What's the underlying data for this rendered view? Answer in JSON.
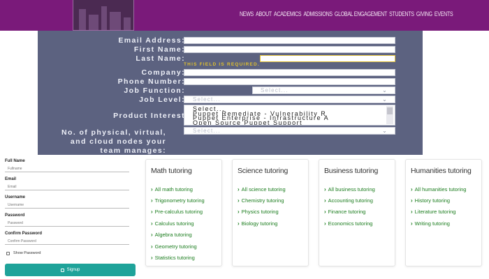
{
  "nav": {
    "items": [
      "NEWS",
      "ABOUT",
      "ACADEMICS",
      "ADMISSIONS",
      "GLOBAL ENGAGEMENT",
      "STUDENTS",
      "GIVING",
      "EVENTS"
    ]
  },
  "lead_form": {
    "email_label": "Email Address:",
    "first_name_label": "First Name:",
    "last_name_label": "Last Name:",
    "last_name_error": "THIS FIELD IS REQUIRED.",
    "company_label": "Company:",
    "phone_label": "Phone Number:",
    "job_function_label": "Job Function:",
    "job_function_placeholder": "Select...",
    "job_level_label": "Job Level:",
    "job_level_placeholder": "Select...",
    "product_interest_label": "Product Interest",
    "product_interest_options": [
      "Select...",
      "Puppet Remediate - Vulnerability R",
      "Puppet Enterprise - Infrastructure A",
      "Open Source Puppet Support"
    ],
    "nodes_label": "No. of physical, virtual, and cloud nodes your team manages:",
    "nodes_placeholder": "Select..."
  },
  "signup": {
    "full_name_label": "Full Name",
    "full_name_placeholder": "Fullname",
    "email_label": "Email",
    "email_placeholder": "Email",
    "username_label": "Username",
    "username_placeholder": "Username",
    "password_label": "Password",
    "password_placeholder": "Password",
    "confirm_label": "Confirm Password",
    "confirm_placeholder": "Confirm Password",
    "show_password": "Show Password",
    "signup_button": "Signup"
  },
  "cards": [
    {
      "title": "Math tutoring",
      "links": [
        "All math tutoring",
        "Trigonometry tutoring",
        "Pre-calculus tutoring",
        "Calculus tutoring",
        "Algebra tutoring",
        "Geometry tutoring",
        "Statistics tutoring"
      ]
    },
    {
      "title": "Science tutoring",
      "links": [
        "All science tutoring",
        "Chemistry tutoring",
        "Physics tutoring",
        "Biology tutoring"
      ]
    },
    {
      "title": "Business tutoring",
      "links": [
        "All business tutoring",
        "Accounting tutoring",
        "Finance tutoring",
        "Economics tutoring"
      ]
    },
    {
      "title": "Humanities tutoring",
      "links": [
        "All humanities tutoring",
        "History tutoring",
        "Literature tutoring",
        "Writing tutoring"
      ]
    }
  ],
  "colors": {
    "nav_bg": "#7a1a7a",
    "form_bg": "#5c6280",
    "error": "#e0c02e",
    "link": "#1b7d1e",
    "button": "#1fa39a"
  }
}
